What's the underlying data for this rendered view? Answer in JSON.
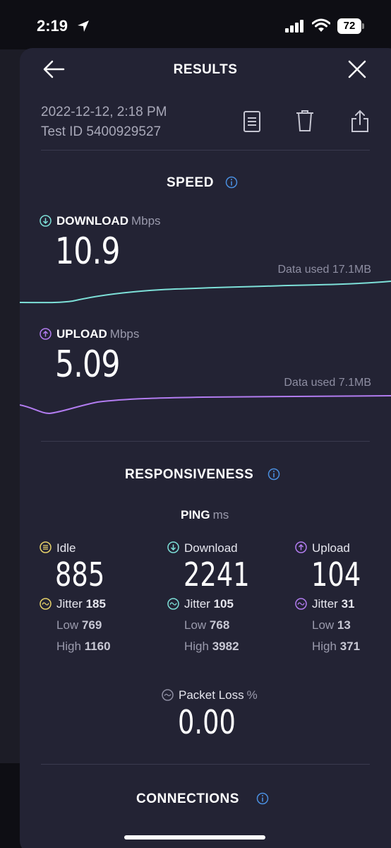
{
  "status": {
    "time": "2:19",
    "battery": "72"
  },
  "header": {
    "title": "RESULTS"
  },
  "meta": {
    "date": "2022-12-12, 2:18 PM",
    "test_id": "Test ID 5400929527"
  },
  "speed": {
    "title": "SPEED",
    "download": {
      "label": "DOWNLOAD",
      "unit": "Mbps",
      "value": "10.9",
      "data_used": "Data used 17.1MB"
    },
    "upload": {
      "label": "UPLOAD",
      "unit": "Mbps",
      "value": "5.09",
      "data_used": "Data used 7.1MB"
    }
  },
  "responsiveness": {
    "title": "RESPONSIVENESS",
    "ping_label": "PING",
    "ping_unit": "ms",
    "columns": [
      {
        "label": "Idle",
        "value": "885",
        "jitter_label": "Jitter",
        "jitter": "185",
        "low_label": "Low",
        "low": "769",
        "high_label": "High",
        "high": "1160"
      },
      {
        "label": "Download",
        "value": "2241",
        "jitter_label": "Jitter",
        "jitter": "105",
        "low_label": "Low",
        "low": "768",
        "high_label": "High",
        "high": "3982"
      },
      {
        "label": "Upload",
        "value": "104",
        "jitter_label": "Jitter",
        "jitter": "31",
        "low_label": "Low",
        "low": "13",
        "high_label": "High",
        "high": "371"
      }
    ],
    "packet_loss": {
      "label": "Packet Loss",
      "unit": "%",
      "value": "0.00"
    }
  },
  "connections": {
    "title": "CONNECTIONS"
  },
  "colors": {
    "download": "#7de0d8",
    "upload": "#b27cf0",
    "idle": "#e8d36a",
    "accent": "#4a8fe0"
  },
  "icons": [
    "location-arrow-icon",
    "signal-icon",
    "wifi-icon",
    "back-arrow-icon",
    "close-icon",
    "document-icon",
    "trash-icon",
    "share-icon",
    "info-icon"
  ]
}
